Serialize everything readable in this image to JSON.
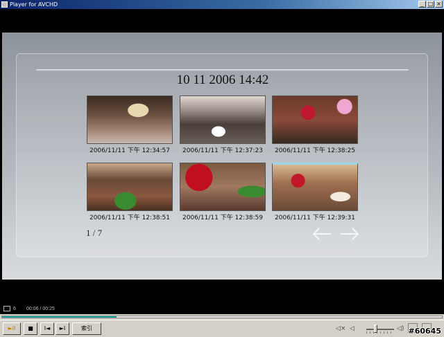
{
  "window": {
    "title": "Player for AVCHD",
    "minimize": "_",
    "maximize": "□",
    "close": "×"
  },
  "menu": {
    "datetime": "10 11 2006  14:42",
    "page_indicator": "1 / 7",
    "thumbnails": [
      {
        "caption": "2006/11/11 下午 12:34:57",
        "scene": "banquet-hall"
      },
      {
        "caption": "2006/11/11 下午 12:37:23",
        "scene": "aisle-walk"
      },
      {
        "caption": "2006/11/11 下午 12:38:25",
        "scene": "balloon-stage"
      },
      {
        "caption": "2006/11/11 下午 12:38:51",
        "scene": "flower-stage"
      },
      {
        "caption": "2006/11/11 下午 12:38:59",
        "scene": "heart-decor"
      },
      {
        "caption": "2006/11/11 下午 12:39:31",
        "scene": "cake-cutting"
      }
    ],
    "selected_index": 5
  },
  "status": {
    "chapter": "6",
    "time": "00:06 / 00:25",
    "progress": 0.26
  },
  "controls": {
    "play_pause": "►II",
    "stop": "■",
    "prev": "I◄",
    "next": "►I",
    "index_label": "索引",
    "volume_level": 0.3
  },
  "watermark": "#60645",
  "colors": {
    "progress_fill": "#1aa8a0",
    "selection": "#9ad4ea"
  }
}
